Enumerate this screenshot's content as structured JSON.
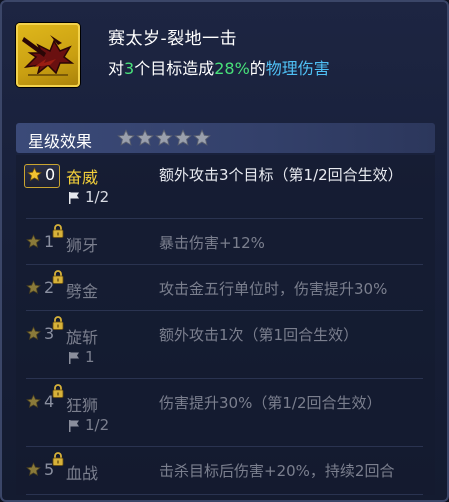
{
  "skill": {
    "title": "赛太岁-裂地一击",
    "desc_prefix": "对",
    "desc_targets": "3",
    "desc_mid": "个目标造成",
    "desc_percent": "28%",
    "desc_of": "的",
    "desc_damage_type": "物理伤害"
  },
  "star_section": {
    "title": "星级效果",
    "star_count": 5,
    "stars_filled": 0
  },
  "levels": [
    {
      "rank": "0",
      "name": "奋威",
      "desc": "额外攻击3个目标（第1/2回合生效）",
      "turns": "1/2",
      "locked": false,
      "active": true
    },
    {
      "rank": "1",
      "name": "狮牙",
      "desc": "暴击伤害+12%",
      "turns": "",
      "locked": true,
      "active": false
    },
    {
      "rank": "2",
      "name": "劈金",
      "desc": "攻击金五行单位时，伤害提升30%",
      "turns": "",
      "locked": true,
      "active": false
    },
    {
      "rank": "3",
      "name": "旋斩",
      "desc": "额外攻击1次（第1回合生效）",
      "turns": "1",
      "locked": true,
      "active": false
    },
    {
      "rank": "4",
      "name": "狂狮",
      "desc": "伤害提升30%（第1/2回合生效）",
      "turns": "1/2",
      "locked": true,
      "active": false
    },
    {
      "rank": "5",
      "name": "血战",
      "desc": "击杀目标后伤害+20%，持续2回合",
      "turns": "",
      "locked": true,
      "active": false
    }
  ],
  "colors": {
    "highlight_green": "#48e07a",
    "highlight_blue": "#4fc0f5",
    "active_name": "#f3cf3a"
  },
  "icons": {
    "skill": "lion-slash-skill-icon",
    "star": "star-icon",
    "lock": "lock-icon",
    "flag": "flag-icon"
  }
}
